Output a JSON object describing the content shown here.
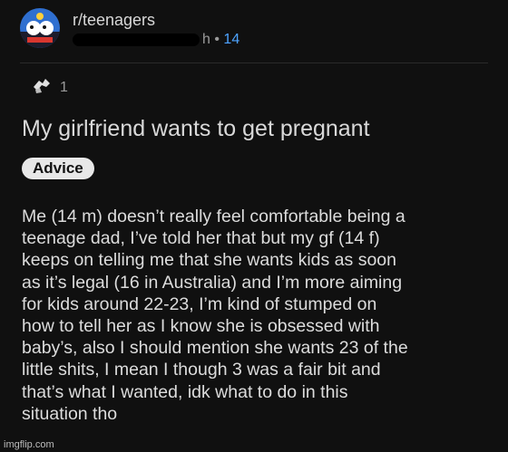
{
  "post": {
    "subreddit": "r/teenagers",
    "age_suffix": "h",
    "separator": "•",
    "count": "14",
    "award_count": "1",
    "title": "My girlfriend wants to get pregnant",
    "flair": "Advice",
    "body_lines": [
      "Me (14 m) doesn’t really feel comfortable being a",
      "teenage dad, I’ve told her that but my gf (14 f)",
      "keeps on telling me that she wants kids as soon",
      "as it’s legal (16 in Australia) and I’m more aiming",
      "for kids around 22-23, I’m kind of stumped on",
      "how to tell her as I know she is obsessed with",
      "baby’s, also I should mention she wants 23 of the",
      "little shits, I mean I though 3 was a fair bit and",
      "that’s what I wanted, idk what to do in this",
      "situation tho"
    ]
  },
  "watermark": "imgflip.com",
  "colors": {
    "background": "#101010",
    "accent": "#4da3ff",
    "flair_bg": "#e8e8e8"
  },
  "icons": {
    "avatar": "subreddit-avatar-icon",
    "award": "award-icon"
  }
}
